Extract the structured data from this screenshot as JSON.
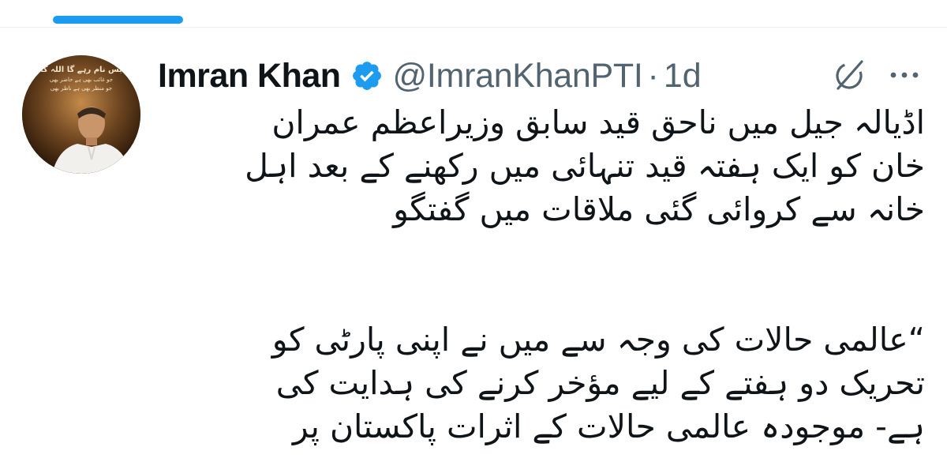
{
  "tweet": {
    "author_name": "Imran Khan",
    "handle": "@ImranKhanPTI",
    "separator": "·",
    "time": "1d",
    "verified": true,
    "avatar_text": [
      "بس نام رہے گا اللہ کا",
      "جو غائب بھی ہے حاضر بھی",
      "جو منظر بھی ہے ناظر بھی"
    ],
    "body_paragraph_1": [
      "اڈیالہ جیل میں ناحق قید سابق وزیراعظم عمران",
      "خان کو ایک ہفتہ قید تنہائی میں رکھنے کے بعد اہل",
      "خانہ سے کروائی گئی ملاقات میں گفتگو"
    ],
    "body_paragraph_2": [
      "“عالمی حالات کی وجہ سے میں نے اپنی پارٹی کو",
      "تحریک دو ہفتے کے لیے مؤخر کرنے کی ہدایت کی",
      "ہے- موجودہ عالمی حالات کے اثرات پاکستان پر"
    ]
  },
  "colors": {
    "accent": "#1d9bf0",
    "text_primary": "#0f1419",
    "text_secondary": "#536471",
    "divider": "#eff3f4"
  },
  "icons": {
    "verified": "verified-badge-icon",
    "grok": "grok-icon",
    "more": "more-options-icon"
  }
}
